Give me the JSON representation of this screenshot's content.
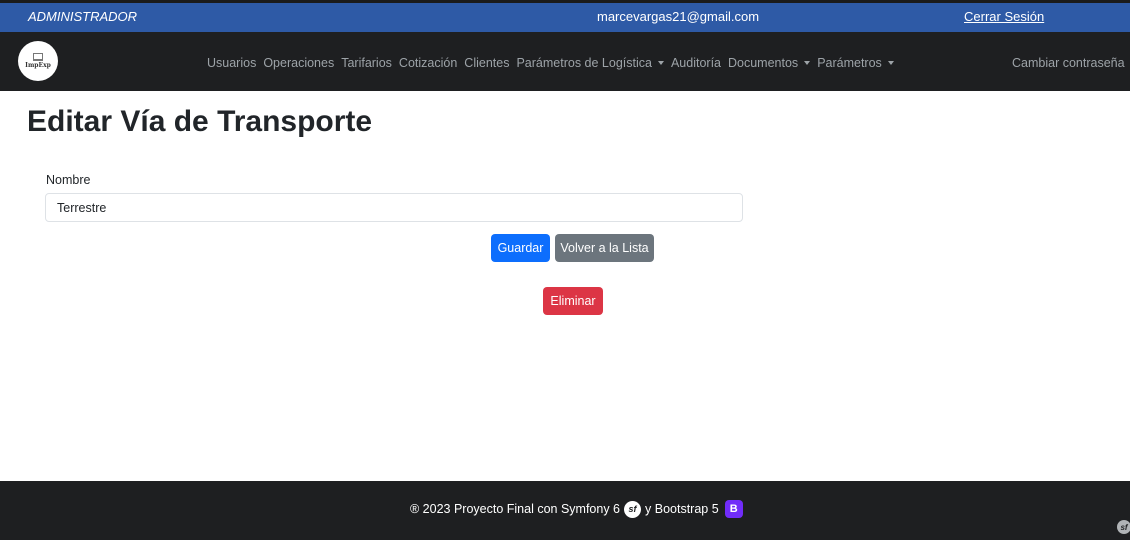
{
  "topbar": {
    "role": "ADMINISTRADOR",
    "email": "marcevargas21@gmail.com",
    "logout": "Cerrar Sesión",
    "color": "#2e5aa6"
  },
  "navbar": {
    "logo_text": "ImpExp",
    "items": [
      {
        "label": "Usuarios"
      },
      {
        "label": "Operaciones"
      },
      {
        "label": "Tarifarios"
      },
      {
        "label": "Cotización"
      },
      {
        "label": "Clientes"
      },
      {
        "label": "Parámetros de Logística"
      },
      {
        "label": "Auditoría"
      },
      {
        "label": "Documentos"
      },
      {
        "label": "Parámetros"
      }
    ],
    "right_item": "Cambiar contraseña"
  },
  "page": {
    "title": "Editar Vía de Transporte"
  },
  "form": {
    "label": "Nombre",
    "value": "Terrestre"
  },
  "buttons": {
    "save": "Guardar",
    "back": "Volver a la Lista",
    "delete": "Eliminar",
    "save_color": "#0d6efd",
    "back_color": "#6c757d",
    "delete_color": "#dc3545"
  },
  "footer": {
    "text_before": "® 2023 Proyecto Final con Symfony 6",
    "text_after": "y Bootstrap 5",
    "symfony_icon": "symfony-icon",
    "bootstrap_icon": "bootstrap-icon"
  }
}
